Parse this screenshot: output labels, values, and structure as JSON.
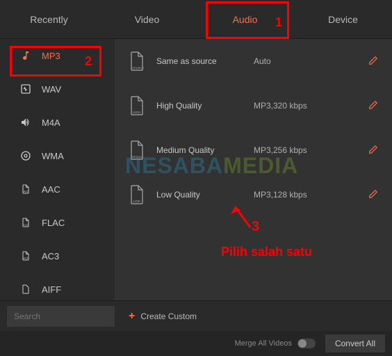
{
  "tabs": {
    "recently": "Recently",
    "video": "Video",
    "audio": "Audio",
    "device": "Device"
  },
  "sidebar": {
    "items": [
      {
        "label": "MP3",
        "icon": "music-note-icon"
      },
      {
        "label": "WAV",
        "icon": "wave-icon"
      },
      {
        "label": "M4A",
        "icon": "sound-icon"
      },
      {
        "label": "WMA",
        "icon": "audio-icon"
      },
      {
        "label": "AAC",
        "icon": "aac-icon"
      },
      {
        "label": "FLAC",
        "icon": "flac-icon"
      },
      {
        "label": "AC3",
        "icon": "ac3-icon"
      },
      {
        "label": "AIFF",
        "icon": "aiff-icon"
      }
    ]
  },
  "presets": [
    {
      "name": "Same as source",
      "spec": "Auto",
      "icon_label": "SOURCE"
    },
    {
      "name": "High Quality",
      "spec": "MP3,320 kbps",
      "icon_label": "HIGH"
    },
    {
      "name": "Medium Quality",
      "spec": "MP3,256 kbps",
      "icon_label": "MEDIUM"
    },
    {
      "name": "Low Quality",
      "spec": "MP3,128 kbps",
      "icon_label": "LOW"
    }
  ],
  "search": {
    "placeholder": "Search"
  },
  "create_custom": "Create Custom",
  "footer": {
    "merge": "Merge All Videos",
    "convert": "Convert All"
  },
  "annotations": {
    "n1": "1",
    "n2": "2",
    "n3": "3",
    "hint": "Pilih salah satu"
  },
  "watermark": {
    "p1": "NESABA",
    "p2": "MEDIA"
  }
}
